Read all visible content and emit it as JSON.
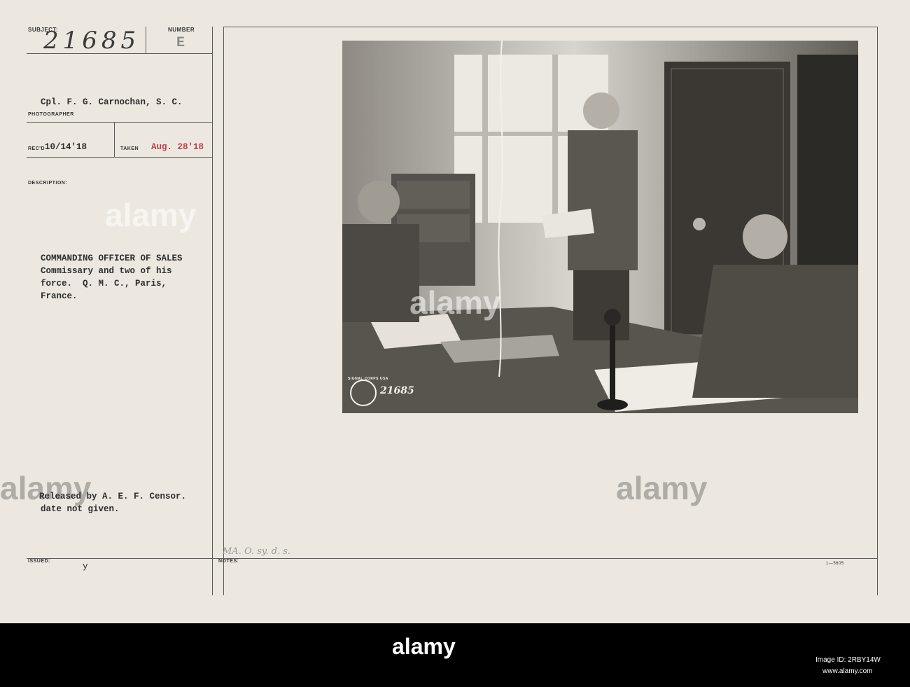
{
  "card": {
    "subject_label": "SUBJECT:",
    "number_label": "NUMBER",
    "subject_number": "21685",
    "number_letter": "E",
    "photographer_name": "Cpl. F. G. Carnochan, S. C.",
    "photographer_label": "PHOTOGRAPHER",
    "rec_label": "REC'D",
    "rec_date": "10/14'18",
    "taken_label": "TAKEN",
    "taken_date": "Aug. 28'18",
    "description_label": "DESCRIPTION:",
    "description_lines": [
      "COMMANDING OFFICER OF SALES",
      "Commissary and two of his",
      "force.  Q. M. C., Paris,",
      "France."
    ],
    "release_lines": [
      "Released by A. E. F. Censor.",
      "date not given."
    ],
    "issued_label": "ISSUED:",
    "issued_mark": "y",
    "notes_label": "NOTES:",
    "notes_handwriting": "MA. O. sy. d. s.",
    "form_number": "1—5605",
    "photo_stamp_number": "21685",
    "photo_stamp_text": "SIGNAL CORPS USA"
  },
  "footer": {
    "brand": "alamy",
    "image_id_label": "Image ID: 2RBY14W",
    "site": "www.alamy.com"
  },
  "watermark": "alamy"
}
